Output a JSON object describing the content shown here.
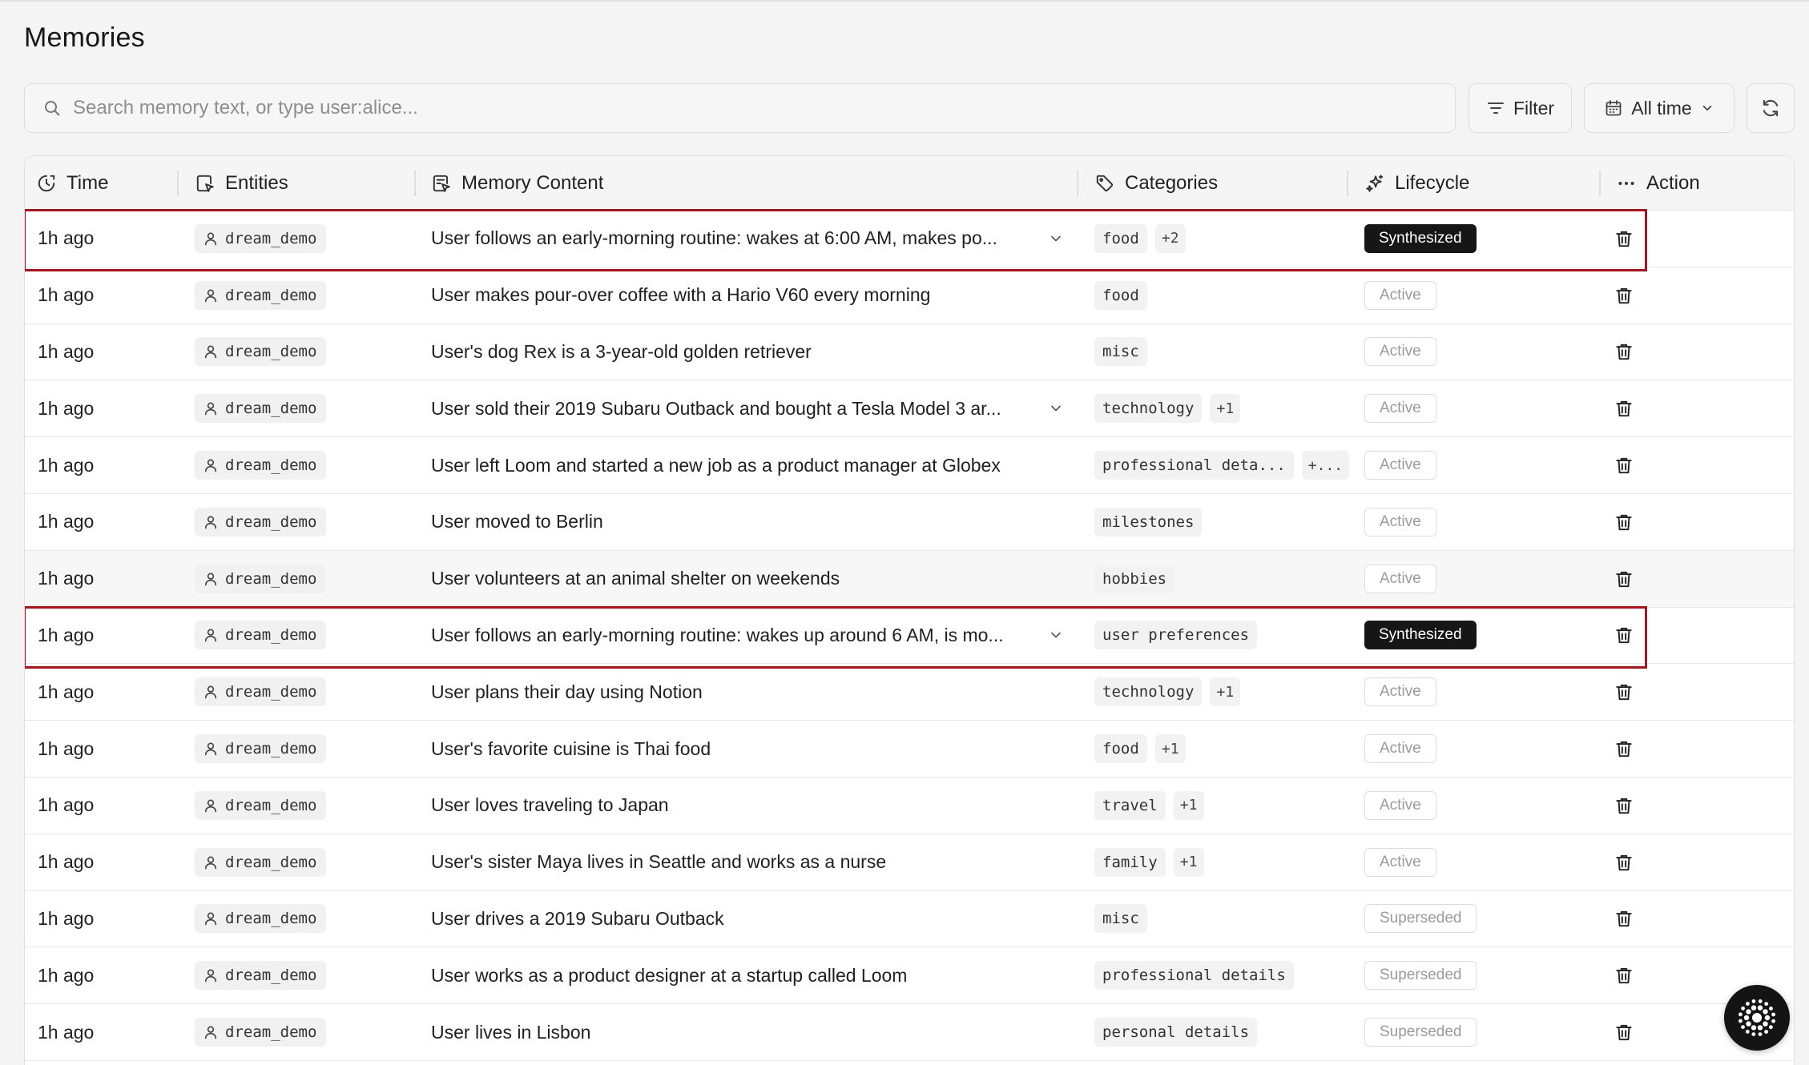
{
  "page": {
    "title": "Memories"
  },
  "search": {
    "placeholder": "Search memory text, or type user:alice..."
  },
  "toolbar": {
    "filter_label": "Filter",
    "time_range_label": "All time"
  },
  "table": {
    "headers": {
      "time": "Time",
      "entities": "Entities",
      "content": "Memory Content",
      "categories": "Categories",
      "lifecycle": "Lifecycle",
      "action": "Action"
    },
    "rows": [
      {
        "time": "1h ago",
        "entity": "dream_demo",
        "content": "User follows an early-morning routine: wakes at 6:00 AM, makes po...",
        "expandable": true,
        "categories": [
          "food"
        ],
        "more": "+2",
        "lifecycle": "Synthesized",
        "highlighted": true
      },
      {
        "time": "1h ago",
        "entity": "dream_demo",
        "content": "User makes pour-over coffee with a Hario V60 every morning",
        "expandable": false,
        "categories": [
          "food"
        ],
        "more": "",
        "lifecycle": "Active",
        "highlighted": false
      },
      {
        "time": "1h ago",
        "entity": "dream_demo",
        "content": "User's dog Rex is a 3-year-old golden retriever",
        "expandable": false,
        "categories": [
          "misc"
        ],
        "more": "",
        "lifecycle": "Active",
        "highlighted": false
      },
      {
        "time": "1h ago",
        "entity": "dream_demo",
        "content": "User sold their 2019 Subaru Outback and bought a Tesla Model 3 ar...",
        "expandable": true,
        "categories": [
          "technology"
        ],
        "more": "+1",
        "lifecycle": "Active",
        "highlighted": false
      },
      {
        "time": "1h ago",
        "entity": "dream_demo",
        "content": "User left Loom and started a new job as a product manager at Globex",
        "expandable": false,
        "categories": [
          "professional deta..."
        ],
        "more": "+...",
        "lifecycle": "Active",
        "highlighted": false
      },
      {
        "time": "1h ago",
        "entity": "dream_demo",
        "content": "User moved to Berlin",
        "expandable": false,
        "categories": [
          "milestones"
        ],
        "more": "",
        "lifecycle": "Active",
        "highlighted": false
      },
      {
        "time": "1h ago",
        "entity": "dream_demo",
        "content": "User volunteers at an animal shelter on weekends",
        "expandable": false,
        "categories": [
          "hobbies"
        ],
        "more": "",
        "lifecycle": "Active",
        "highlighted": false,
        "alt": true
      },
      {
        "time": "1h ago",
        "entity": "dream_demo",
        "content": "User follows an early-morning routine: wakes up around 6 AM, is mo...",
        "expandable": true,
        "categories": [
          "user preferences"
        ],
        "more": "",
        "lifecycle": "Synthesized",
        "highlighted": true
      },
      {
        "time": "1h ago",
        "entity": "dream_demo",
        "content": "User plans their day using Notion",
        "expandable": false,
        "categories": [
          "technology"
        ],
        "more": "+1",
        "lifecycle": "Active",
        "highlighted": false
      },
      {
        "time": "1h ago",
        "entity": "dream_demo",
        "content": "User's favorite cuisine is Thai food",
        "expandable": false,
        "categories": [
          "food"
        ],
        "more": "+1",
        "lifecycle": "Active",
        "highlighted": false
      },
      {
        "time": "1h ago",
        "entity": "dream_demo",
        "content": "User loves traveling to Japan",
        "expandable": false,
        "categories": [
          "travel"
        ],
        "more": "+1",
        "lifecycle": "Active",
        "highlighted": false
      },
      {
        "time": "1h ago",
        "entity": "dream_demo",
        "content": "User's sister Maya lives in Seattle and works as a nurse",
        "expandable": false,
        "categories": [
          "family"
        ],
        "more": "+1",
        "lifecycle": "Active",
        "highlighted": false
      },
      {
        "time": "1h ago",
        "entity": "dream_demo",
        "content": "User drives a 2019 Subaru Outback",
        "expandable": false,
        "categories": [
          "misc"
        ],
        "more": "",
        "lifecycle": "Superseded",
        "highlighted": false
      },
      {
        "time": "1h ago",
        "entity": "dream_demo",
        "content": "User works as a product designer at a startup called Loom",
        "expandable": false,
        "categories": [
          "professional details"
        ],
        "more": "",
        "lifecycle": "Superseded",
        "highlighted": false
      },
      {
        "time": "1h ago",
        "entity": "dream_demo",
        "content": "User lives in Lisbon",
        "expandable": false,
        "categories": [
          "personal details"
        ],
        "more": "",
        "lifecycle": "Superseded",
        "highlighted": false
      }
    ]
  },
  "icons": {
    "search": "search-icon",
    "filter": "filter-icon",
    "calendar": "calendar-icon",
    "chevron": "chevron-down-icon",
    "refresh": "refresh-icon",
    "clock": "clock-icon",
    "entity": "entity-icon",
    "content": "content-icon",
    "tag": "tag-icon",
    "sparkle": "sparkle-icon",
    "dots": "dots-icon",
    "user": "user-icon",
    "trash": "trash-icon",
    "assistant": "assistant-logo-icon"
  },
  "colors": {
    "highlight": "#a3151c",
    "synthesized_bg": "#161616",
    "badge_muted": "#9a9a9a"
  }
}
